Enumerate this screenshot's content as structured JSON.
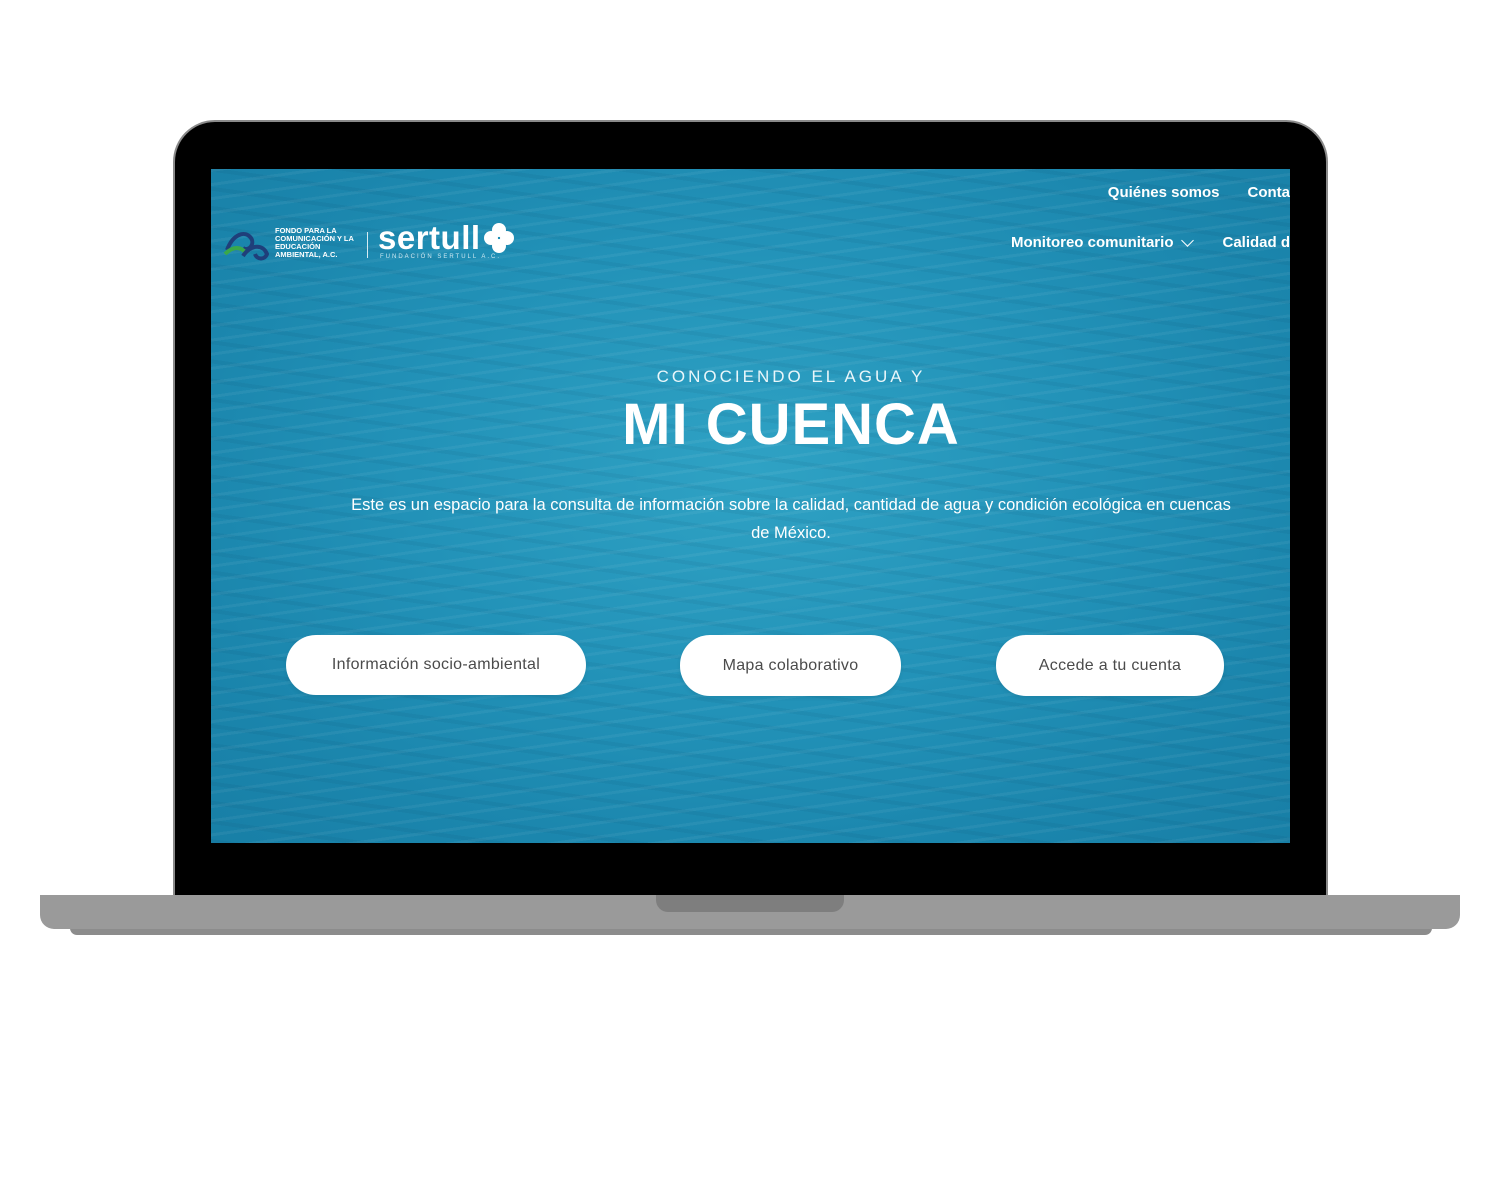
{
  "nav": {
    "top_links": [
      "Quiénes somos",
      "Conta"
    ],
    "main_links": [
      {
        "label": "Monitoreo comunitario",
        "dropdown": true
      },
      {
        "label": "Calidad d",
        "dropdown": false
      }
    ]
  },
  "logos": {
    "fondo_text": "FONDO PARA LA COMUNICACIÓN Y LA EDUCACIÓN AMBIENTAL, A.C.",
    "sertull_name": "sertull",
    "sertull_sub": "FUNDACIÓN SERTULL A.C."
  },
  "hero": {
    "kicker": "CONOCIENDO EL AGUA Y",
    "title": "MI CUENCA",
    "description": "Este es un espacio para la consulta de información sobre la calidad, cantidad de agua y condición ecológica en cuencas de México."
  },
  "buttons": {
    "socio": "Información socio-ambiental",
    "mapa": "Mapa colaborativo",
    "cuenta": "Accede a tu cuenta"
  },
  "colors": {
    "ocean": "#2292b8",
    "laptop_frame": "#000000",
    "laptop_base": "#9a9a9a"
  }
}
